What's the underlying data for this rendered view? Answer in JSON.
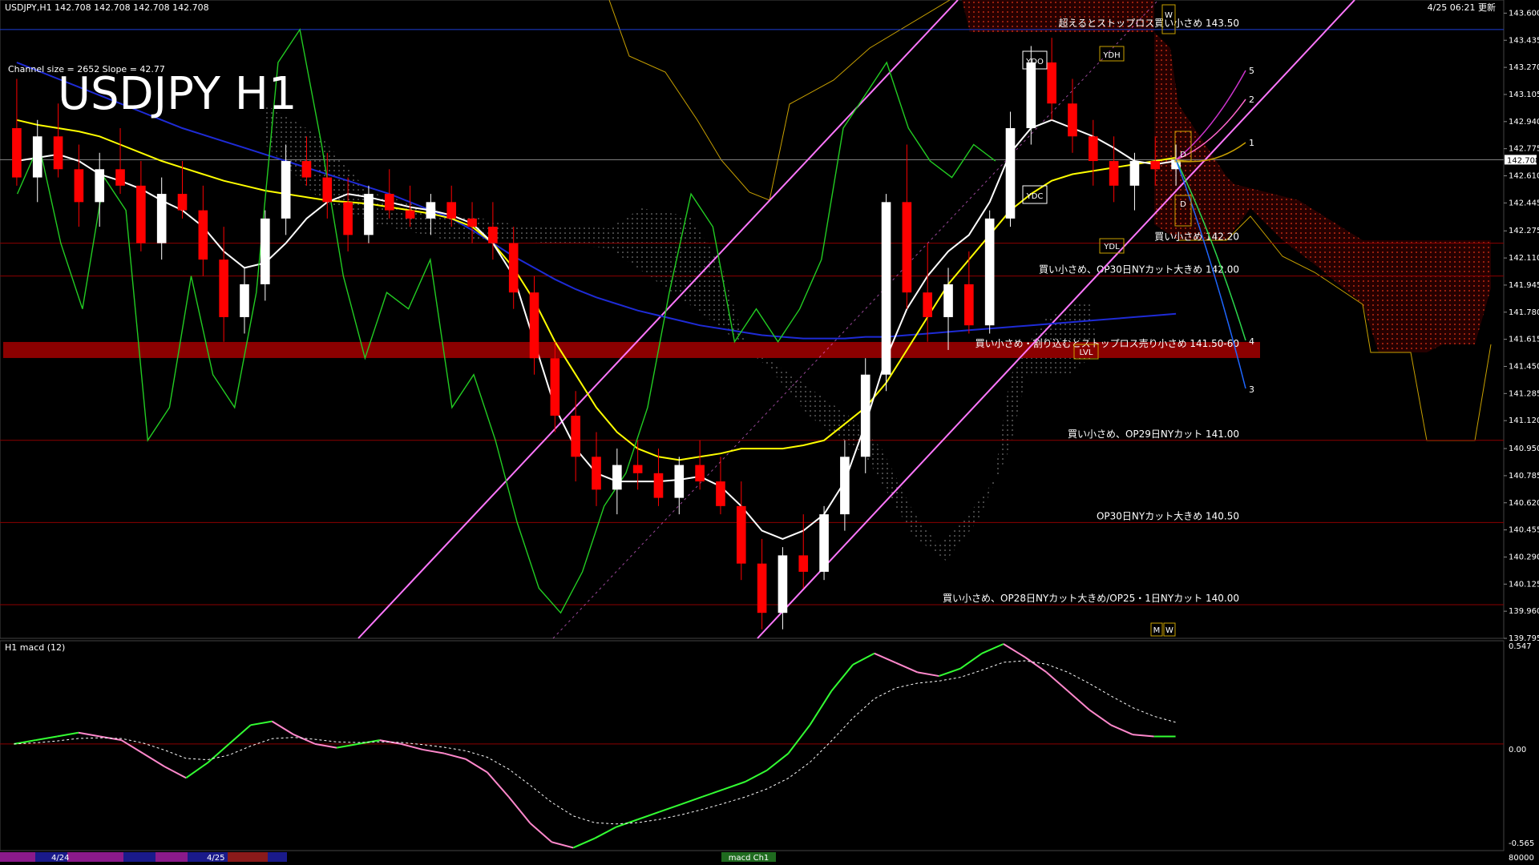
{
  "header": {
    "symbol_line": "USDJPY,H1  142.708 142.708 142.708 142.708",
    "timestamp": "4/25 06:21 更新",
    "channel_info": "Channel size = 2652 Slope = 42.77",
    "big_title": "USDJPY H1"
  },
  "colors": {
    "background": "#000000",
    "bull_candle": "#ffffff",
    "bear_candle": "#ff0000",
    "ma_white": "#ffffff",
    "ma_yellow": "#ffff00",
    "ma_blue": "#1e2bd6",
    "chikou_green": "#22cc22",
    "channel_pink": "#ff77ff",
    "kumo_red": "#ff3a1a",
    "support_zone": "#8b0000",
    "macd_green": "#33ff33",
    "macd_pink": "#ff88cc"
  },
  "price_axis": {
    "labels": [
      "143.600",
      "143.435",
      "143.270",
      "143.105",
      "142.940",
      "142.775",
      "142.610",
      "142.445",
      "142.275",
      "142.110",
      "141.945",
      "141.780",
      "141.615",
      "141.450",
      "141.285",
      "141.120",
      "140.950",
      "140.785",
      "140.620",
      "140.455",
      "140.290",
      "140.125",
      "139.960",
      "139.795"
    ],
    "current_price": "142.708"
  },
  "levels": [
    {
      "price": 143.5,
      "label": "超えるとストップロス買い小さめ 143.50",
      "color": "#1e3fd6"
    },
    {
      "price": 142.2,
      "label": "買い小さめ 142.20",
      "color": "#8b0000"
    },
    {
      "price": 142.0,
      "label": "買い小さめ、OP30日NYカット大きめ 142.00",
      "color": "#8b0000"
    },
    {
      "price": 141.55,
      "label": "買い小さめ・割り込むとストップロス売り小さめ 141.50-60",
      "color": "#8b0000"
    },
    {
      "price": 141.0,
      "label": "買い小さめ、OP29日NYカット 141.00",
      "color": "#8b0000"
    },
    {
      "price": 140.5,
      "label": "OP30日NYカット大きめ 140.50",
      "color": "#8b0000"
    },
    {
      "price": 140.0,
      "label": "買い小さめ、OP28日NYカット大きめ/OP25・1日NYカット 140.00",
      "color": "#8b0000"
    }
  ],
  "markers": {
    "ydo": "YDO",
    "ydh": "YDH",
    "ydc": "YDC",
    "ydl": "YDL",
    "lvl": "LVL",
    "d_top": "D",
    "d_bottom": "D",
    "w_top": "W",
    "m_bottom": "M",
    "w_bottom": "W"
  },
  "projection_numbers": [
    "5",
    "2",
    "1",
    "4",
    "3"
  ],
  "macd_panel": {
    "title": "H1  macd (12)",
    "axis_labels": [
      "0.547",
      "0.00",
      "-0.565"
    ]
  },
  "bottom_axis": {
    "dates": [
      "4/24",
      "4/25"
    ],
    "right_label": "80000",
    "center_label": "macd Ch1"
  },
  "chart_data": {
    "type": "candlestick",
    "title": "USDJPY H1",
    "symbol": "USDJPY",
    "timeframe": "H1",
    "ylim": [
      139.795,
      143.68
    ],
    "x_labels": [
      "4/24",
      "4/25"
    ],
    "ohlc": [
      [
        142.9,
        143.2,
        142.55,
        142.6
      ],
      [
        142.6,
        142.95,
        142.45,
        142.85
      ],
      [
        142.85,
        143.05,
        142.6,
        142.65
      ],
      [
        142.65,
        142.8,
        142.3,
        142.45
      ],
      [
        142.45,
        142.75,
        142.3,
        142.65
      ],
      [
        142.65,
        142.9,
        142.5,
        142.55
      ],
      [
        142.55,
        142.7,
        142.15,
        142.2
      ],
      [
        142.2,
        142.6,
        142.1,
        142.5
      ],
      [
        142.5,
        142.7,
        142.35,
        142.4
      ],
      [
        142.4,
        142.55,
        142.0,
        142.1
      ],
      [
        142.1,
        142.3,
        141.6,
        141.75
      ],
      [
        141.75,
        142.05,
        141.65,
        141.95
      ],
      [
        141.95,
        142.4,
        141.85,
        142.35
      ],
      [
        142.35,
        142.8,
        142.25,
        142.7
      ],
      [
        142.7,
        142.85,
        142.55,
        142.6
      ],
      [
        142.6,
        142.75,
        142.35,
        142.45
      ],
      [
        142.45,
        142.6,
        142.15,
        142.25
      ],
      [
        142.25,
        142.55,
        142.2,
        142.5
      ],
      [
        142.5,
        142.65,
        142.35,
        142.4
      ],
      [
        142.4,
        142.55,
        142.3,
        142.35
      ],
      [
        142.35,
        142.5,
        142.25,
        142.45
      ],
      [
        142.45,
        142.55,
        142.3,
        142.35
      ],
      [
        142.35,
        142.45,
        142.2,
        142.3
      ],
      [
        142.3,
        142.45,
        142.1,
        142.2
      ],
      [
        142.2,
        142.3,
        141.8,
        141.9
      ],
      [
        141.9,
        142.0,
        141.4,
        141.5
      ],
      [
        141.5,
        141.6,
        141.05,
        141.15
      ],
      [
        141.15,
        141.3,
        140.75,
        140.9
      ],
      [
        140.9,
        141.05,
        140.6,
        140.7
      ],
      [
        140.7,
        140.95,
        140.55,
        140.85
      ],
      [
        140.85,
        141.0,
        140.7,
        140.8
      ],
      [
        140.8,
        140.95,
        140.6,
        140.65
      ],
      [
        140.65,
        140.9,
        140.55,
        140.85
      ],
      [
        140.85,
        141.0,
        140.7,
        140.75
      ],
      [
        140.75,
        140.9,
        140.55,
        140.6
      ],
      [
        140.6,
        140.75,
        140.15,
        140.25
      ],
      [
        140.25,
        140.4,
        139.85,
        139.95
      ],
      [
        139.95,
        140.35,
        139.85,
        140.3
      ],
      [
        140.3,
        140.55,
        140.1,
        140.2
      ],
      [
        140.2,
        140.6,
        140.15,
        140.55
      ],
      [
        140.55,
        141.0,
        140.45,
        140.9
      ],
      [
        140.9,
        141.5,
        140.8,
        141.4
      ],
      [
        141.4,
        142.5,
        141.3,
        142.45
      ],
      [
        142.45,
        142.8,
        141.8,
        141.9
      ],
      [
        141.9,
        142.2,
        141.6,
        141.75
      ],
      [
        141.75,
        142.05,
        141.55,
        141.95
      ],
      [
        141.95,
        142.15,
        141.65,
        141.7
      ],
      [
        141.7,
        142.4,
        141.65,
        142.35
      ],
      [
        142.35,
        143.0,
        142.3,
        142.9
      ],
      [
        142.9,
        143.4,
        142.8,
        143.3
      ],
      [
        143.3,
        143.45,
        142.95,
        143.05
      ],
      [
        143.05,
        143.2,
        142.75,
        142.85
      ],
      [
        142.85,
        142.95,
        142.55,
        142.7
      ],
      [
        142.7,
        142.85,
        142.45,
        142.55
      ],
      [
        142.55,
        142.75,
        142.4,
        142.7
      ],
      [
        142.7,
        142.85,
        142.55,
        142.65
      ],
      [
        142.65,
        142.8,
        142.55,
        142.708
      ]
    ],
    "sma_white": [
      142.7,
      142.72,
      142.74,
      142.7,
      142.62,
      142.58,
      142.53,
      142.46,
      142.4,
      142.3,
      142.15,
      142.05,
      142.08,
      142.2,
      142.35,
      142.45,
      142.5,
      142.48,
      142.45,
      142.42,
      142.4,
      142.37,
      142.32,
      142.2,
      142.0,
      141.6,
      141.2,
      140.95,
      140.8,
      140.75,
      140.75,
      140.75,
      140.76,
      140.78,
      140.72,
      140.6,
      140.45,
      140.4,
      140.45,
      140.55,
      140.75,
      141.1,
      141.5,
      141.8,
      142.0,
      142.15,
      142.25,
      142.45,
      142.75,
      142.9,
      142.95,
      142.9,
      142.85,
      142.78,
      142.7,
      142.68,
      142.7
    ],
    "sma_yellow": [
      142.95,
      142.92,
      142.9,
      142.88,
      142.85,
      142.8,
      142.75,
      142.7,
      142.66,
      142.62,
      142.58,
      142.55,
      142.52,
      142.5,
      142.48,
      142.46,
      142.45,
      142.44,
      142.42,
      142.4,
      142.38,
      142.35,
      142.3,
      142.2,
      142.05,
      141.85,
      141.6,
      141.4,
      141.2,
      141.05,
      140.95,
      140.9,
      140.88,
      140.9,
      140.92,
      140.95,
      140.95,
      140.95,
      140.97,
      141.0,
      141.1,
      141.2,
      141.35,
      141.55,
      141.75,
      141.95,
      142.1,
      142.25,
      142.4,
      142.5,
      142.58,
      142.62,
      142.64,
      142.66,
      142.68,
      142.7,
      142.72
    ],
    "sma_blue": [
      143.3,
      143.25,
      143.2,
      143.15,
      143.1,
      143.05,
      143.0,
      142.95,
      142.9,
      142.86,
      142.82,
      142.78,
      142.74,
      142.7,
      142.66,
      142.62,
      142.58,
      142.54,
      142.5,
      142.45,
      142.4,
      142.35,
      142.28,
      142.2,
      142.12,
      142.05,
      141.98,
      141.92,
      141.87,
      141.83,
      141.79,
      141.76,
      141.73,
      141.7,
      141.68,
      141.66,
      141.64,
      141.63,
      141.62,
      141.62,
      141.62,
      141.63,
      141.63,
      141.64,
      141.65,
      141.66,
      141.67,
      141.68,
      141.69,
      141.7,
      141.71,
      141.72,
      141.73,
      141.74,
      141.75,
      141.76,
      141.77
    ],
    "chikou_green": [
      142.5,
      142.8,
      142.2,
      141.8,
      142.6,
      142.4,
      141.0,
      141.2,
      142.0,
      141.4,
      141.2,
      141.9,
      143.3,
      143.5,
      142.8,
      142.0,
      141.5,
      141.9,
      141.8,
      142.1,
      141.2,
      141.4,
      141.0,
      140.5,
      140.1,
      139.95,
      140.2,
      140.6,
      140.8,
      141.2,
      141.9,
      142.5,
      142.3,
      141.6,
      141.8,
      141.6,
      141.8,
      142.1,
      142.9,
      143.1,
      143.3,
      142.9,
      142.7,
      142.6,
      142.8,
      142.7
    ],
    "macd": [
      0.0,
      0.02,
      0.04,
      0.06,
      0.04,
      0.02,
      -0.05,
      -0.12,
      -0.18,
      -0.1,
      0.0,
      0.1,
      0.12,
      0.05,
      0.0,
      -0.02,
      0.0,
      0.02,
      0.0,
      -0.03,
      -0.05,
      -0.08,
      -0.15,
      -0.28,
      -0.42,
      -0.52,
      -0.55,
      -0.5,
      -0.44,
      -0.4,
      -0.36,
      -0.32,
      -0.28,
      -0.24,
      -0.2,
      -0.14,
      -0.05,
      0.1,
      0.28,
      0.42,
      0.48,
      0.43,
      0.38,
      0.36,
      0.4,
      0.48,
      0.53,
      0.46,
      0.38,
      0.28,
      0.18,
      0.1,
      0.05,
      0.04,
      0.04
    ]
  }
}
